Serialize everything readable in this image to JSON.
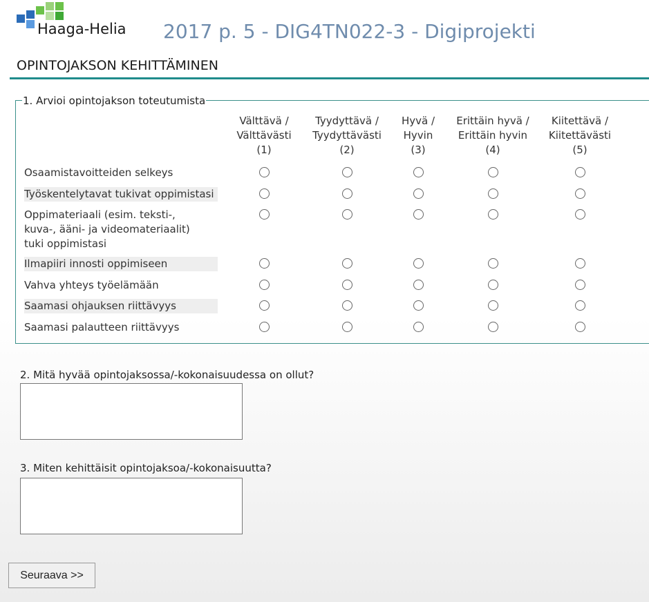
{
  "header": {
    "logo_text": "Haaga-Helia",
    "title": "2017 p. 5 - DIG4TN022-3 - Digiprojekti"
  },
  "section": {
    "title": "OPINTOJAKSON KEHITTÄMINEN"
  },
  "q1": {
    "legend": "1. Arvioi opintojakson toteutumista",
    "columns": [
      {
        "line1": "Välttävä /",
        "line2": "Välttävästi",
        "line3": "(1)"
      },
      {
        "line1": "Tyydyttävä /",
        "line2": "Tyydyttävästi",
        "line3": "(2)"
      },
      {
        "line1": "Hyvä /",
        "line2": "Hyvin",
        "line3": "(3)"
      },
      {
        "line1": "Erittäin hyvä /",
        "line2": "Erittäin hyvin",
        "line3": "(4)"
      },
      {
        "line1": "Kiitettävä /",
        "line2": "Kiitettävästi",
        "line3": "(5)"
      }
    ],
    "rows": [
      {
        "label": "Osaamistavoitteiden selkeys"
      },
      {
        "label": "Työskentelytavat tukivat oppimistasi"
      },
      {
        "label": "Oppimateriaali (esim. teksti-, kuva-, ääni- ja videomateriaalit) tuki oppimistasi"
      },
      {
        "label": "Ilmapiiri innosti oppimiseen"
      },
      {
        "label": "Vahva yhteys työelämään"
      },
      {
        "label": "Saamasi ohjauksen riittävyys"
      },
      {
        "label": "Saamasi palautteen riittävyys"
      }
    ]
  },
  "q2": {
    "label": "2. Mitä hyvää opintojaksossa/-kokonaisuudessa on ollut?",
    "value": ""
  },
  "q3": {
    "label": "3. Miten kehittäisit opintojaksoa/-kokonaisuutta?",
    "value": ""
  },
  "buttons": {
    "next_label": "Seuraava >>"
  },
  "colors": {
    "title": "#6f8cad",
    "accent": "#1f8b8b",
    "logo_blue": "#2b6cb8",
    "logo_green": "#6cc24a"
  },
  "icons": {
    "logo": "haaga-helia-logo-icon"
  }
}
